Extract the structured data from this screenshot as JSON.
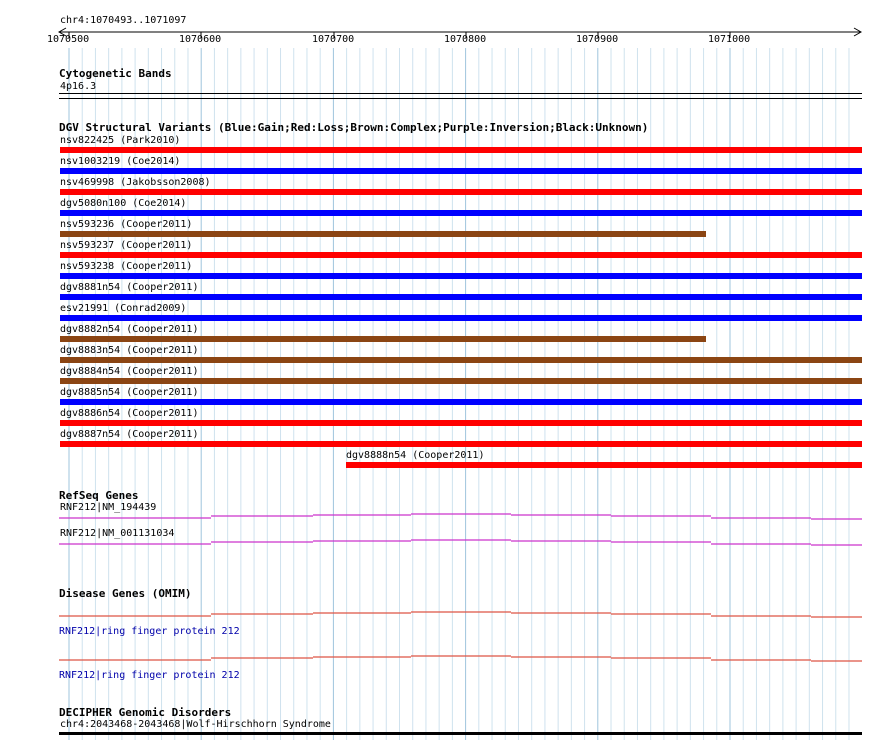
{
  "ruler": {
    "label": "chr4:1070493..1071097",
    "ticks": [
      "1070500",
      "1070600",
      "1070700",
      "1070800",
      "1070900",
      "1071000"
    ]
  },
  "cytoband": {
    "title": "Cytogenetic Bands",
    "band": "4p16.3"
  },
  "dgv": {
    "title": "DGV Structural Variants (Blue:Gain;Red:Loss;Brown:Complex;Purple:Inversion;Black:Unknown)",
    "colors": {
      "gain": "#ff0000",
      "loss": "#0000ff",
      "complex": "#8b4513",
      "red": "#ff0000",
      "blue": "#0000ff",
      "brown": "#8b4513"
    },
    "variants": [
      {
        "label": "nsv822425 (Park2010)",
        "color": "red",
        "partial": false
      },
      {
        "label": "nsv1003219 (Coe2014)",
        "color": "blue",
        "partial": false
      },
      {
        "label": "nsv469998 (Jakobsson2008)",
        "color": "red",
        "partial": false
      },
      {
        "label": "dgv5080n100 (Coe2014)",
        "color": "blue",
        "partial": false
      },
      {
        "label": "nsv593236 (Cooper2011)",
        "color": "brown",
        "partial": true
      },
      {
        "label": "nsv593237 (Cooper2011)",
        "color": "red",
        "partial": false
      },
      {
        "label": "nsv593238 (Cooper2011)",
        "color": "blue",
        "partial": false
      },
      {
        "label": "dgv8881n54 (Cooper2011)",
        "color": "blue",
        "partial": false
      },
      {
        "label": "esv21991 (Conrad2009)",
        "color": "blue",
        "partial": false
      },
      {
        "label": "dgv8882n54 (Cooper2011)",
        "color": "brown",
        "partial": true
      },
      {
        "label": "dgv8883n54 (Cooper2011)",
        "color": "brown",
        "partial": false
      },
      {
        "label": "dgv8884n54 (Cooper2011)",
        "color": "brown",
        "partial": false
      },
      {
        "label": "dgv8885n54 (Cooper2011)",
        "color": "blue",
        "partial": false
      },
      {
        "label": "dgv8886n54 (Cooper2011)",
        "color": "red",
        "partial": false
      },
      {
        "label": "dgv8887n54 (Cooper2011)",
        "color": "red",
        "partial": false
      },
      {
        "label": "dgv8888n54 (Cooper2011)",
        "color": "red",
        "partial": false,
        "late": true
      }
    ]
  },
  "refseq": {
    "title": "RefSeq Genes",
    "color": "#cc33cc",
    "genes": [
      {
        "label": "RNF212|NM_194439"
      },
      {
        "label": "RNF212|NM_001131034"
      }
    ]
  },
  "omim": {
    "title": "Disease Genes (OMIM)",
    "color": "#dd5544",
    "genes": [
      {
        "label": "RNF212|ring finger protein 212"
      },
      {
        "label": "RNF212|ring finger protein 212"
      }
    ]
  },
  "decipher": {
    "title": "DECIPHER Genomic Disorders",
    "entry": "chr4:2043468-2043468|Wolf-Hirschhorn Syndrome"
  }
}
